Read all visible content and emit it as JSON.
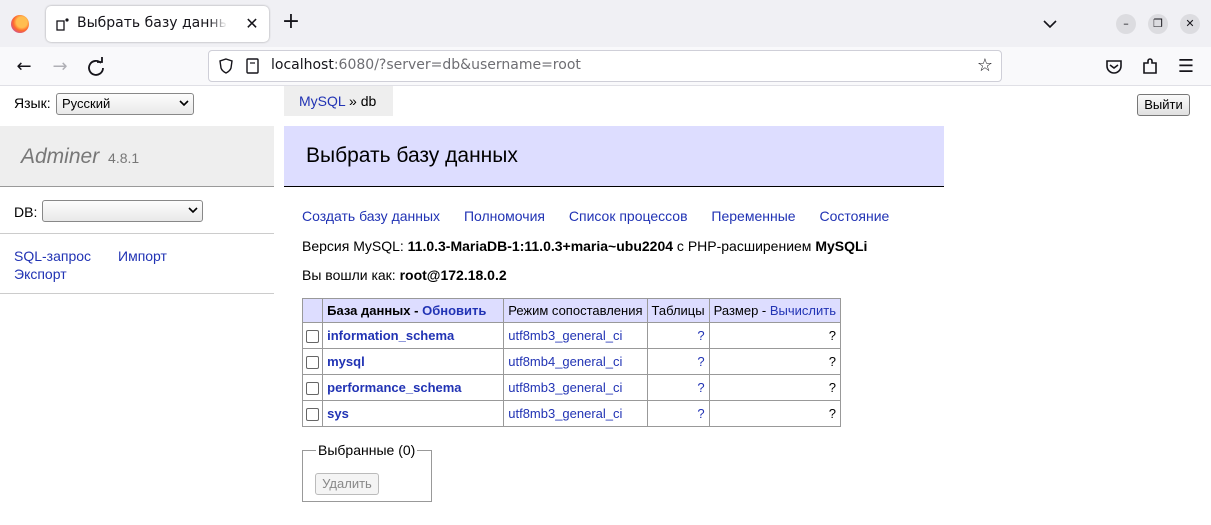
{
  "browser": {
    "tab_title": "Выбрать базу данных - Ad",
    "url_host": "localhost",
    "url_rest": ":6080/?server=db&username=root"
  },
  "page": {
    "language_label": "Язык:",
    "language_value": "Русский",
    "breadcrumb": {
      "link": "MySQL",
      "separator": "»",
      "current": "db"
    },
    "logout_label": "Выйти",
    "brand": "Adminer",
    "brand_version": "4.8.1",
    "db_label": "DB:",
    "sidebar_links": {
      "sql": "SQL-запрос",
      "import": "Импорт",
      "export": "Экспорт"
    },
    "heading": "Выбрать базу данных",
    "top_links": [
      "Создать базу данных",
      "Полномочия",
      "Список процессов",
      "Переменные",
      "Состояние"
    ],
    "version_prefix": "Версия MySQL: ",
    "version_value": "11.0.3-MariaDB-1:11.0.3+maria~ubu2204",
    "version_mid": " с PHP-расширением ",
    "version_ext": "MySQLi",
    "logged_prefix": "Вы вошли как: ",
    "logged_value": "root@172.18.0.2",
    "table": {
      "headers": {
        "db": "База данных",
        "db_sep": " - ",
        "refresh": "Обновить",
        "collation": "Режим сопоставления",
        "tables": "Таблицы",
        "size": "Размер",
        "size_sep": " - ",
        "compute": "Вычислить"
      },
      "rows": [
        {
          "name": "information_schema",
          "collation": "utf8mb3_general_ci",
          "tables": "?",
          "size": "?"
        },
        {
          "name": "mysql",
          "collation": "utf8mb4_general_ci",
          "tables": "?",
          "size": "?"
        },
        {
          "name": "performance_schema",
          "collation": "utf8mb3_general_ci",
          "tables": "?",
          "size": "?"
        },
        {
          "name": "sys",
          "collation": "utf8mb3_general_ci",
          "tables": "?",
          "size": "?"
        }
      ]
    },
    "selected_legend": "Выбранные (0)",
    "delete_label": "Удалить"
  }
}
